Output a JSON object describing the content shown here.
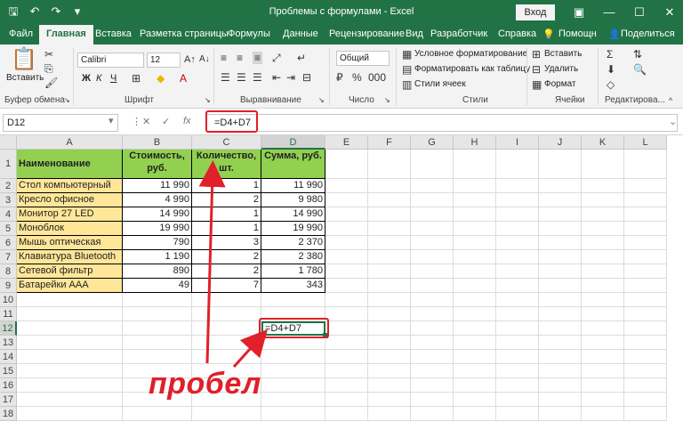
{
  "titlebar": {
    "title": "Проблемы с формулами - Excel",
    "login": "Вход"
  },
  "tabs": [
    "Файл",
    "Главная",
    "Вставка",
    "Разметка страницы",
    "Формулы",
    "Данные",
    "Рецензирование",
    "Вид",
    "Разработчик",
    "Справка",
    "Помощн",
    "Поделиться"
  ],
  "ribbon": {
    "paste": "Вставить",
    "font_name": "Calibri",
    "font_size": "12",
    "number_format": "Общий",
    "bold": "Ж",
    "italic": "К",
    "underline": "Ч",
    "conditional": "Условное форматирование",
    "format_table": "Форматировать как таблицу",
    "cell_styles": "Стили ячеек",
    "insert": "Вставить",
    "delete": "Удалить",
    "format": "Формат",
    "groups": {
      "clipboard": "Буфер обмена",
      "font": "Шрифт",
      "alignment": "Выравнивание",
      "number": "Число",
      "styles": "Стили",
      "cells": "Ячейки",
      "editing": "Редактирова..."
    }
  },
  "formula_bar": {
    "name_box": "D12",
    "fx": "fx",
    "formula": "=D4+D7"
  },
  "grid": {
    "columns": [
      "A",
      "B",
      "C",
      "D",
      "E",
      "F",
      "G",
      "H",
      "I",
      "J",
      "K",
      "L"
    ],
    "rows": [
      "1",
      "2",
      "3",
      "4",
      "5",
      "6",
      "7",
      "8",
      "9",
      "10",
      "11",
      "12",
      "13",
      "14",
      "15",
      "16",
      "17",
      "18"
    ],
    "headers": {
      "name": "Наименование",
      "cost": "Стоимость, руб.",
      "qty": "Количество, шт.",
      "sum": "Сумма, руб."
    },
    "data": [
      {
        "name": "Стол компьютерный",
        "cost": "11 990",
        "qty": "1",
        "sum": "11 990"
      },
      {
        "name": "Кресло офисное",
        "cost": "4 990",
        "qty": "2",
        "sum": "9 980"
      },
      {
        "name": "Монитор 27 LED",
        "cost": "14 990",
        "qty": "1",
        "sum": "14 990"
      },
      {
        "name": "Моноблок",
        "cost": "19 990",
        "qty": "1",
        "sum": "19 990"
      },
      {
        "name": "Мышь оптическая",
        "cost": "790",
        "qty": "3",
        "sum": "2 370"
      },
      {
        "name": "Клавиатура Bluetooth",
        "cost": "1 190",
        "qty": "2",
        "sum": "2 380"
      },
      {
        "name": "Сетевой фильтр",
        "cost": "890",
        "qty": "2",
        "sum": "1 780"
      },
      {
        "name": "Батарейки AAA",
        "cost": "49",
        "qty": "7",
        "sum": "343"
      }
    ],
    "active_cell_text": "=D4+D7"
  },
  "annotation": {
    "word": "пробел",
    "color": "#e0202a"
  },
  "colors": {
    "brand": "#217346",
    "header_fill": "#92d050",
    "name_fill": "#ffe699"
  }
}
